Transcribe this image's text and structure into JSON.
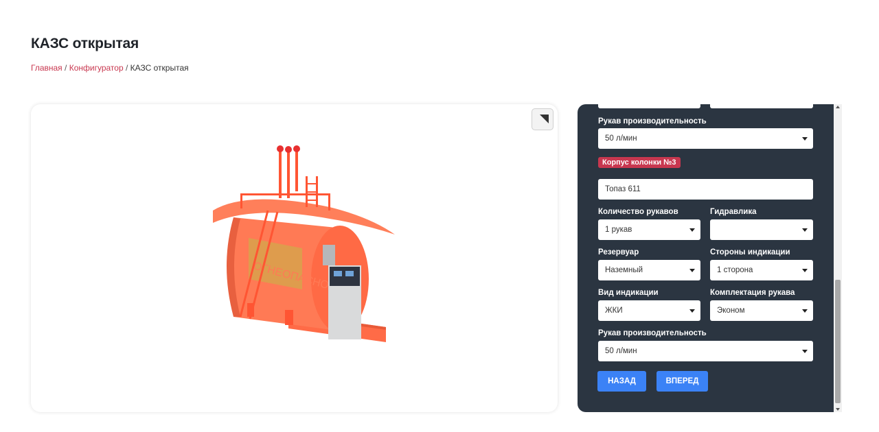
{
  "page": {
    "title": "КАЗС открытая",
    "breadcrumb": {
      "home": "Главная",
      "configurator": "Конфигуратор",
      "separator": "/",
      "current": "КАЗС открытая"
    }
  },
  "viewer": {
    "expand_icon": "expand-corner-icon",
    "tank_lettering": "ОГНЕОПАСНО"
  },
  "config": {
    "top_hose_capacity_label": "Рукав производительность",
    "top_hose_capacity_value": "50 л/мин",
    "section_badge": "Корпус колонки №3",
    "column_model_value": "Топаз 611",
    "hose_count_label": "Количество рукавов",
    "hose_count_value": "1 рукав",
    "hydraulics_label": "Гидравлика",
    "hydraulics_value": "",
    "reservoir_label": "Резервуар",
    "reservoir_value": "Наземный",
    "indication_sides_label": "Стороны индикации",
    "indication_sides_value": "1 сторона",
    "indication_type_label": "Вид индикации",
    "indication_type_value": "ЖКИ",
    "hose_kit_label": "Комплектация рукава",
    "hose_kit_value": "Эконом",
    "bottom_hose_capacity_label": "Рукав производительность",
    "bottom_hose_capacity_value": "50 л/мин",
    "back_button": "НАЗАД",
    "next_button": "ВПЕРЕД"
  },
  "colors": {
    "accent": "#c8374f",
    "panel_bg": "#2b3541",
    "button": "#3b82f6",
    "tank": "#ff6b47"
  }
}
